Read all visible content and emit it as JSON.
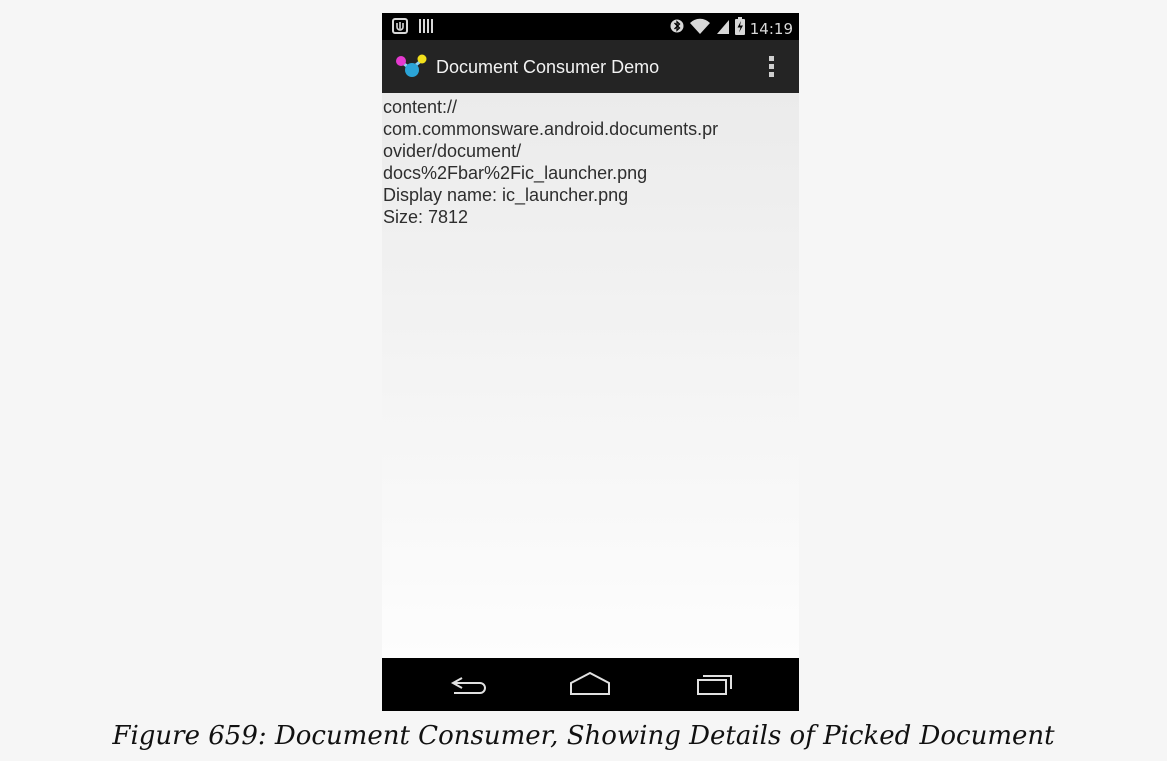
{
  "status_bar": {
    "time": "14:19",
    "left_icons": [
      "usb-debug-icon",
      "barcode-icon"
    ],
    "right_icons": [
      "bluetooth-icon",
      "wifi-icon",
      "signal-icon",
      "battery-charging-icon"
    ]
  },
  "action_bar": {
    "title": "Document Consumer Demo",
    "app_icon": "app-launcher-icon",
    "menu_icon": "overflow-menu-icon"
  },
  "content": {
    "lines": [
      "content://",
      "com.commonsware.android.documents.pr",
      "ovider/document/",
      "docs%2Fbar%2Fic_launcher.png",
      "Display name: ic_launcher.png",
      "Size: 7812"
    ]
  },
  "nav_bar": {
    "buttons": [
      "back-icon",
      "home-icon",
      "recent-apps-icon"
    ]
  },
  "caption": "Figure 659: Document Consumer, Showing Details of Picked Document"
}
